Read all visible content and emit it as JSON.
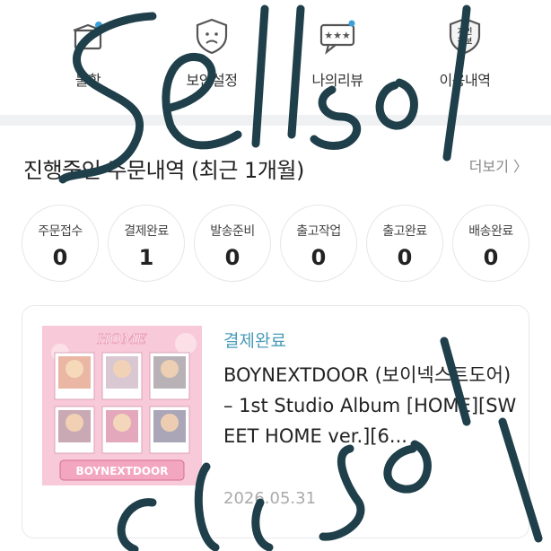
{
  "nav": {
    "items": [
      {
        "label": "물함",
        "icon": "box-icon"
      },
      {
        "label": "보안설정",
        "icon": "shield-icon"
      },
      {
        "label": "나의리뷰",
        "icon": "review-chat-icon"
      },
      {
        "label": "이용내역",
        "icon": "privacy-icon",
        "badge": "개인\n정보"
      }
    ]
  },
  "orders": {
    "title": "진행중인 주문내역 (최근 1개월)",
    "more": "더보기 〉",
    "statuses": [
      {
        "label": "주문접수",
        "count": "0"
      },
      {
        "label": "결제완료",
        "count": "1"
      },
      {
        "label": "발송준비",
        "count": "0"
      },
      {
        "label": "출고작업",
        "count": "0"
      },
      {
        "label": "출고완료",
        "count": "0"
      },
      {
        "label": "배송완료",
        "count": "0"
      }
    ],
    "card": {
      "status": "결제완료",
      "title": "BOYNEXTDOOR (보이넥스트도어) – 1st Studio Album [HOME][SWEET HOME ver.][6...",
      "date": "2026.05.31",
      "album_text_top": "HOME",
      "album_text_bottom": "BOYNEXTDOOR"
    }
  },
  "overlay": {
    "handwriting": "sell sold"
  },
  "colors": {
    "accent": "#4a9bb7",
    "divider": "#f0f1f3",
    "ink": "#1f3f4a",
    "album_bg": "#f7c6d6"
  }
}
